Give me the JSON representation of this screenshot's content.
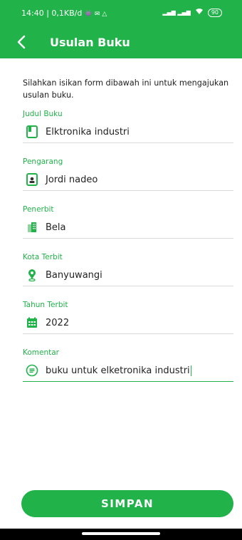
{
  "status_bar": {
    "time_info": "14:40 | 0,1KB/d",
    "notif_icons": "👾 ✉ △",
    "signal_icons": "▂▄▆ ▂▄▆",
    "battery": "90"
  },
  "app_bar": {
    "title": "Usulan Buku"
  },
  "intro": "Silahkan isikan form dibawah ini untuk mengajukan usulan buku.",
  "fields": [
    {
      "label": "Judul Buku",
      "value": "Elktronika industri",
      "icon": "book-icon"
    },
    {
      "label": "Pengarang",
      "value": "Jordi nadeo",
      "icon": "person-badge-icon"
    },
    {
      "label": "Penerbit",
      "value": "Bela",
      "icon": "building-icon"
    },
    {
      "label": "Kota Terbit",
      "value": "Banyuwangi",
      "icon": "location-pin-icon"
    },
    {
      "label": "Tahun Terbit",
      "value": "2022",
      "icon": "calendar-icon"
    },
    {
      "label": "Komentar",
      "value": "buku untuk elketronika industri",
      "icon": "comment-icon"
    }
  ],
  "save_label": "SIMPAN",
  "colors": {
    "accent": "#21b24a"
  }
}
